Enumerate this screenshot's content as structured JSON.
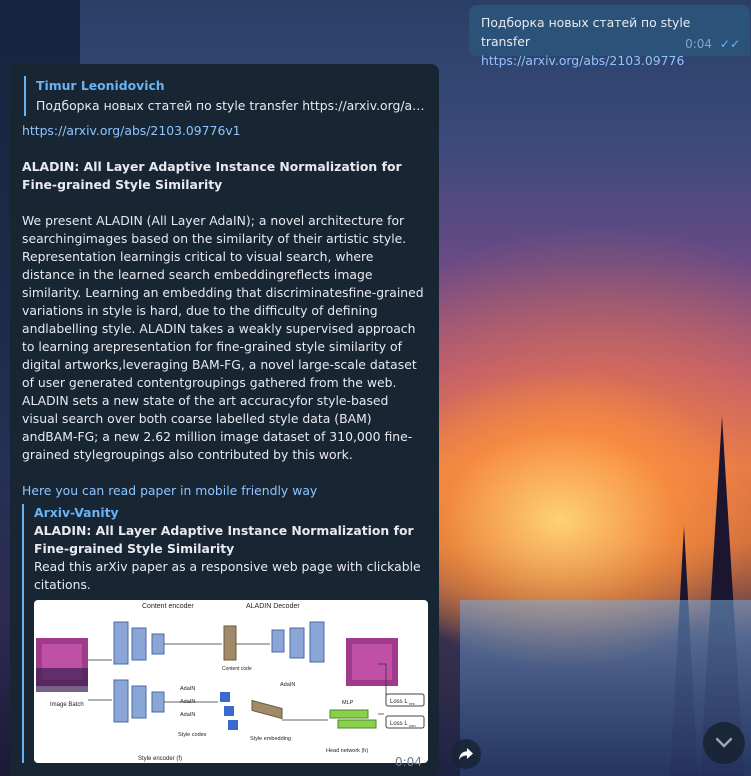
{
  "outgoing": {
    "text": "Подборка новых статей по style transfer",
    "link": "https://arxiv.org/abs/2103.09776",
    "time": "0:04",
    "status_icon": "double-check-icon"
  },
  "incoming": {
    "reply": {
      "author": "Timur Leonidovich",
      "text": "Подборка новых статей по style transfer https://arxiv.org/abs/..."
    },
    "link": "https://arxiv.org/abs/2103.09776v1",
    "title": "ALADIN: All Layer Adaptive Instance Normalization for Fine-grained Style Similarity",
    "abstract": "We present ALADIN (All Layer AdaIN); a novel architecture for searchingimages based on the similarity of their artistic style. Representation learningis critical to visual search, where distance in the learned search embeddingreflects image similarity. Learning an embedding that discriminatesfine-grained variations in style is hard, due to the difficulty of defining andlabelling style. ALADIN takes a weakly supervised approach to learning arepresentation for fine-grained style similarity of digital artworks,leveraging BAM-FG, a novel large-scale dataset of user generated contentgroupings gathered from the web. ALADIN sets a new state of the art accuracyfor style-based visual search over both coarse labelled style data (BAM) andBAM-FG; a new 2.62 million image dataset of 310,000 fine-grained stylegroupings also contributed by this work.",
    "mobile_link": "Here you can read paper in mobile friendly way",
    "preview": {
      "site": "Arxiv-Vanity",
      "title": "ALADIN: All Layer Adaptive Instance Normalization for Fine-grained Style Similarity",
      "description": "Read this arXiv paper as a responsive web page with clickable citations."
    },
    "time": "0:04",
    "diagram_labels": {
      "content_encoder": "Content encoder",
      "aladin_decoder": "ALADIN Decoder",
      "content_code": "Content code",
      "image_batch": "Image Batch",
      "adain": "AdaIN",
      "style_codes": "Style codes",
      "style_embedding": "Style embedding",
      "style_encoder": "Style encoder (f)",
      "mlp": "MLP",
      "head_network": "Head network (h)",
      "loss_rec": "Loss L",
      "loss_rec_sub": "rec",
      "loss_con": "Loss L",
      "loss_con_sub": "con"
    }
  },
  "buttons": {
    "share_icon": "share-arrow-icon",
    "scroll_icon": "chevron-down-icon"
  }
}
